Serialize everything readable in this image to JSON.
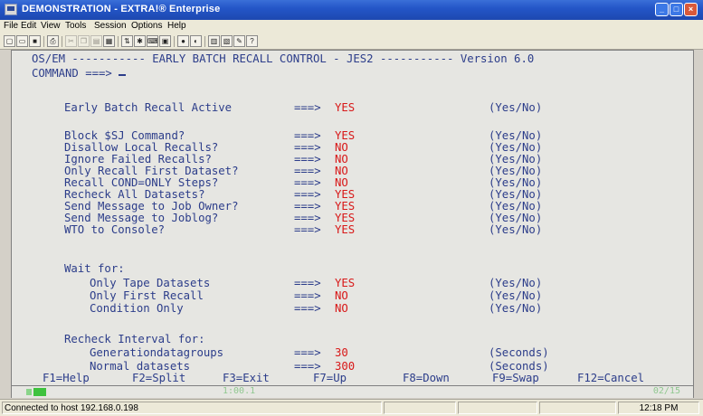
{
  "window": {
    "title": "DEMONSTRATION - EXTRA!® Enterprise",
    "controls": {
      "minimize": "_",
      "maximize": "□",
      "close": "×"
    }
  },
  "menu": [
    "File",
    "Edit",
    "View",
    "Tools",
    "Session",
    "Options",
    "Help"
  ],
  "toolbar": {
    "icons": [
      "new-icon",
      "open-icon",
      "save-icon",
      "print-icon",
      "cut-icon",
      "copy-icon",
      "paste-icon",
      "macro-icon",
      "transfer-icon",
      "settings-icon",
      "keyboard-icon",
      "display-icon",
      "connect-icon",
      "disconnect-icon",
      "quickpad-icon",
      "toolbar-icon",
      "edit-icon",
      "help-icon"
    ]
  },
  "screen": {
    "header": "OS/EM ----------- EARLY BATCH RECALL CONTROL - JES2 ----------- Version 6.0",
    "command_prompt": "COMMAND ===>",
    "settings": [
      {
        "label": "Early Batch Recall Active",
        "arrow": "===>",
        "value": "YES",
        "hint": "(Yes/No)"
      },
      {
        "label": "Block $SJ Command?",
        "arrow": "===>",
        "value": "YES",
        "hint": "(Yes/No)"
      },
      {
        "label": "Disallow Local Recalls?",
        "arrow": "===>",
        "value": "NO",
        "hint": "(Yes/No)"
      },
      {
        "label": "Ignore Failed Recalls?",
        "arrow": "===>",
        "value": "NO",
        "hint": "(Yes/No)"
      },
      {
        "label": "Only Recall First Dataset?",
        "arrow": "===>",
        "value": "NO",
        "hint": "(Yes/No)"
      },
      {
        "label": "Recall COND=ONLY Steps?",
        "arrow": "===>",
        "value": "NO",
        "hint": "(Yes/No)"
      },
      {
        "label": "Recheck All Datasets?",
        "arrow": "===>",
        "value": "YES",
        "hint": "(Yes/No)"
      },
      {
        "label": "Send Message to Job Owner?",
        "arrow": "===>",
        "value": "YES",
        "hint": "(Yes/No)"
      },
      {
        "label": "Send Message to Joblog?",
        "arrow": "===>",
        "value": "YES",
        "hint": "(Yes/No)"
      },
      {
        "label": "WTO to Console?",
        "arrow": "===>",
        "value": "YES",
        "hint": "(Yes/No)"
      }
    ],
    "wait_for": {
      "heading": "Wait for:",
      "items": [
        {
          "label": "Only Tape Datasets",
          "arrow": "===>",
          "value": "YES",
          "hint": "(Yes/No)"
        },
        {
          "label": "Only First Recall",
          "arrow": "===>",
          "value": "NO",
          "hint": "(Yes/No)"
        },
        {
          "label": "Condition Only",
          "arrow": "===>",
          "value": "NO",
          "hint": "(Yes/No)"
        }
      ]
    },
    "recheck": {
      "heading": "Recheck Interval for:",
      "items": [
        {
          "label": "Generationdatagroups",
          "arrow": "===>",
          "value": "30",
          "hint": "(Seconds)"
        },
        {
          "label": "Normal datasets",
          "arrow": "===>",
          "value": "300",
          "hint": "(Seconds)"
        }
      ]
    },
    "pf_keys": [
      {
        "key": "F1=Help"
      },
      {
        "key": "F2=Split"
      },
      {
        "key": "F3=Exit"
      },
      {
        "key": "F7=Up"
      },
      {
        "key": "F8=Down"
      },
      {
        "key": "F9=Swap"
      },
      {
        "key": "F12=Cancel"
      }
    ]
  },
  "oia": {
    "session": "1:00.1",
    "cursor_pos": "02/15"
  },
  "status": {
    "text": "Connected to host 192.168.0.198",
    "time": "12:18 PM"
  }
}
